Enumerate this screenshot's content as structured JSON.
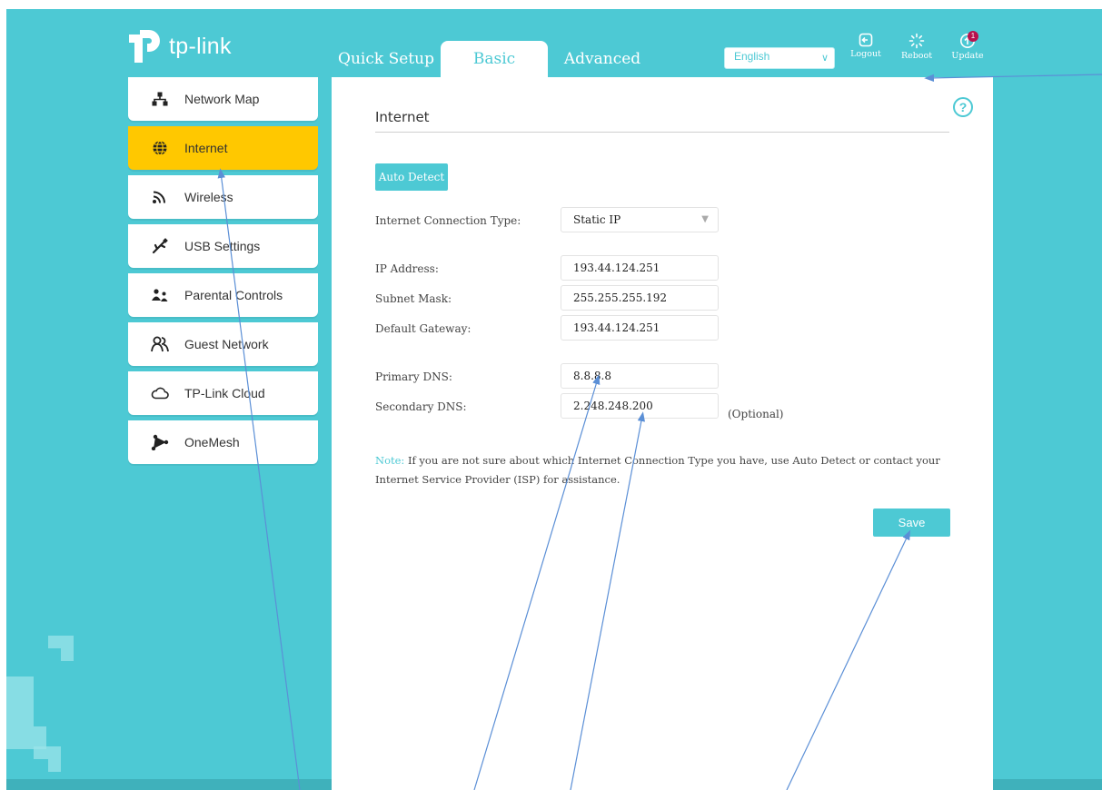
{
  "brand": {
    "logo_text": "tp-link"
  },
  "tabs": [
    {
      "label": "Quick Setup",
      "active": false
    },
    {
      "label": "Basic",
      "active": true
    },
    {
      "label": "Advanced",
      "active": false
    }
  ],
  "language": {
    "selected": "English"
  },
  "header_actions": [
    {
      "label": "Logout",
      "icon": "logout-icon"
    },
    {
      "label": "Reboot",
      "icon": "reboot-icon"
    },
    {
      "label": "Update",
      "icon": "update-icon",
      "badge": "1"
    }
  ],
  "sidebar": {
    "items": [
      {
        "label": "Network Map",
        "icon": "network-map-icon",
        "active": false
      },
      {
        "label": "Internet",
        "icon": "globe-icon",
        "active": true
      },
      {
        "label": "Wireless",
        "icon": "wifi-icon",
        "active": false
      },
      {
        "label": "USB Settings",
        "icon": "usb-icon",
        "active": false
      },
      {
        "label": "Parental Controls",
        "icon": "parental-icon",
        "active": false
      },
      {
        "label": "Guest Network",
        "icon": "guest-icon",
        "active": false
      },
      {
        "label": "TP-Link Cloud",
        "icon": "cloud-icon",
        "active": false
      },
      {
        "label": "OneMesh",
        "icon": "onemesh-icon",
        "active": false
      }
    ]
  },
  "main": {
    "title": "Internet",
    "help_icon": "?",
    "auto_detect_label": "Auto Detect",
    "connection_type": {
      "label": "Internet Connection Type:",
      "value": "Static IP"
    },
    "fields": {
      "ip_address": {
        "label": "IP Address:",
        "value": "193.44.124.251"
      },
      "subnet_mask": {
        "label": "Subnet Mask:",
        "value": "255.255.255.192"
      },
      "default_gateway": {
        "label": "Default Gateway:",
        "value": "193.44.124.251"
      },
      "primary_dns": {
        "label": "Primary DNS:",
        "value": "8.8.8.8"
      },
      "secondary_dns": {
        "label": "Secondary DNS:",
        "value": "2.248.248.200",
        "suffix": "(Optional)"
      }
    },
    "note": {
      "label": "Note:",
      "text": "If you are not sure about which Internet Connection Type you have, use Auto Detect or contact your Internet Service Provider (ISP) for assistance."
    },
    "save_label": "Save"
  },
  "colors": {
    "accent": "#4dc9d4",
    "active_nav": "#ffc800",
    "badge": "#b8124e",
    "annotation": "#5b8fd6"
  }
}
